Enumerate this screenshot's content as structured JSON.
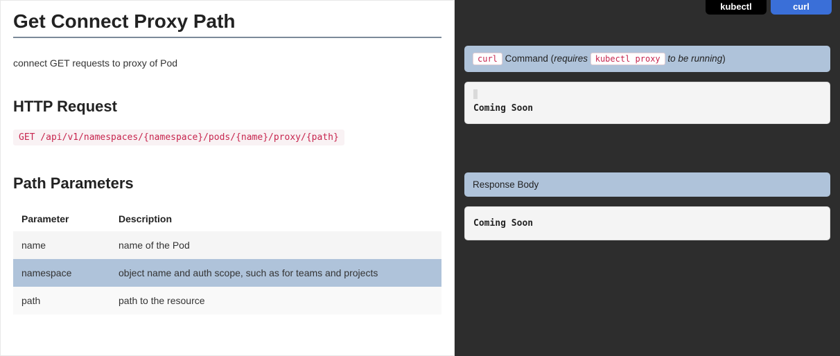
{
  "page": {
    "title": "Get Connect Proxy Path",
    "description": "connect GET requests to proxy of Pod"
  },
  "http_request": {
    "heading": "HTTP Request",
    "line": "GET /api/v1/namespaces/{namespace}/pods/{name}/proxy/{path}"
  },
  "path_params": {
    "heading": "Path Parameters",
    "columns": {
      "param": "Parameter",
      "desc": "Description"
    },
    "rows": [
      {
        "param": "name",
        "desc": "name of the Pod"
      },
      {
        "param": "namespace",
        "desc": "object name and auth scope, such as for teams and projects"
      },
      {
        "param": "path",
        "desc": "path to the resource"
      }
    ]
  },
  "tabs": {
    "kubectl": "kubectl",
    "curl": "curl"
  },
  "right": {
    "cmd_header": {
      "code1": "curl",
      "text1": " Command (",
      "em": "requires ",
      "code2": "kubectl proxy",
      "em2": " to be running",
      "text2": ")"
    },
    "coming1": "Coming Soon",
    "resp_header": "Response Body",
    "coming2": "Coming Soon"
  }
}
